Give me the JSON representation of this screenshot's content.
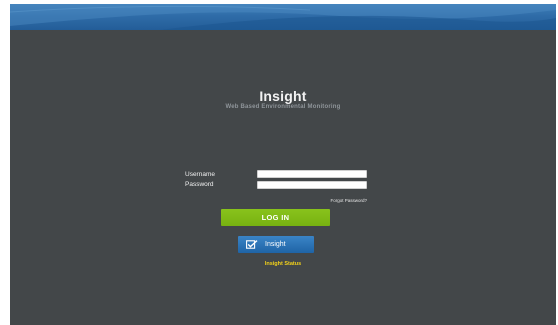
{
  "app": {
    "title": "Insight",
    "subtitle": "Web Based Environmental Monitoring"
  },
  "login_form": {
    "username_label": "Username",
    "password_label": "Password",
    "username_value": "",
    "password_value": "",
    "forgot_password_link": "Forgot Password?",
    "login_button": "LOG IN"
  },
  "insight_button": {
    "label": "Insight",
    "icon": "checkbox-icon"
  },
  "status_link": "Insight Status",
  "colors": {
    "background": "#434749",
    "banner": "#2f6ca8",
    "login_button": "#7ab813",
    "insight_button": "#2b74b8",
    "status_link": "#f2d11a"
  }
}
